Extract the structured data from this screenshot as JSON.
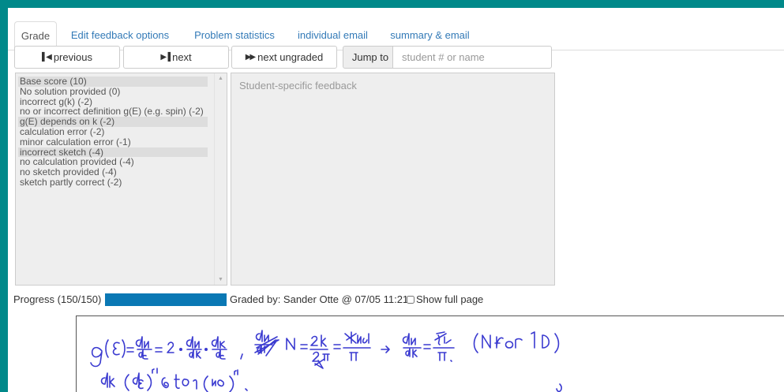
{
  "tabs": [
    {
      "label": "Grade",
      "active": true
    },
    {
      "label": "Edit feedback options",
      "active": false
    },
    {
      "label": "Problem statistics",
      "active": false
    },
    {
      "label": "individual email",
      "active": false
    },
    {
      "label": "summary & email",
      "active": false
    }
  ],
  "toolbar": {
    "previous_label": "previous",
    "next_label": "next",
    "next_ungraded_label": "next ungraded",
    "jump_label": "Jump to",
    "jump_placeholder": "student # or name"
  },
  "rubric": {
    "items": [
      {
        "label": "Base score (10)",
        "selected": true
      },
      {
        "label": "No solution provided (0)",
        "selected": false
      },
      {
        "label": "incorrect g(k) (-2)",
        "selected": false
      },
      {
        "label": "no or incorrect definition g(E) (e.g. spin) (-2)",
        "selected": false
      },
      {
        "label": "g(E) depends on k (-2)",
        "selected": true
      },
      {
        "label": "calculation error (-2)",
        "selected": false
      },
      {
        "label": "minor calculation error (-1)",
        "selected": false
      },
      {
        "label": "incorrect sketch (-4)",
        "selected": true
      },
      {
        "label": "no calculation provided (-4)",
        "selected": false
      },
      {
        "label": "no sketch provided (-4)",
        "selected": false
      },
      {
        "label": "sketch partly correct (-2)",
        "selected": false
      }
    ]
  },
  "feedback": {
    "placeholder": "Student-specific feedback",
    "value": ""
  },
  "progress": {
    "label": "Progress (150/150)",
    "fraction": 1.0
  },
  "graded_by": "Graded by: Sander Otte @ 07/05 11:21",
  "show_full_page": {
    "label": "Show full page",
    "checked": false
  },
  "colors": {
    "accent": "#337ab7",
    "progress": "#0a78b4",
    "background": "#00898a"
  }
}
